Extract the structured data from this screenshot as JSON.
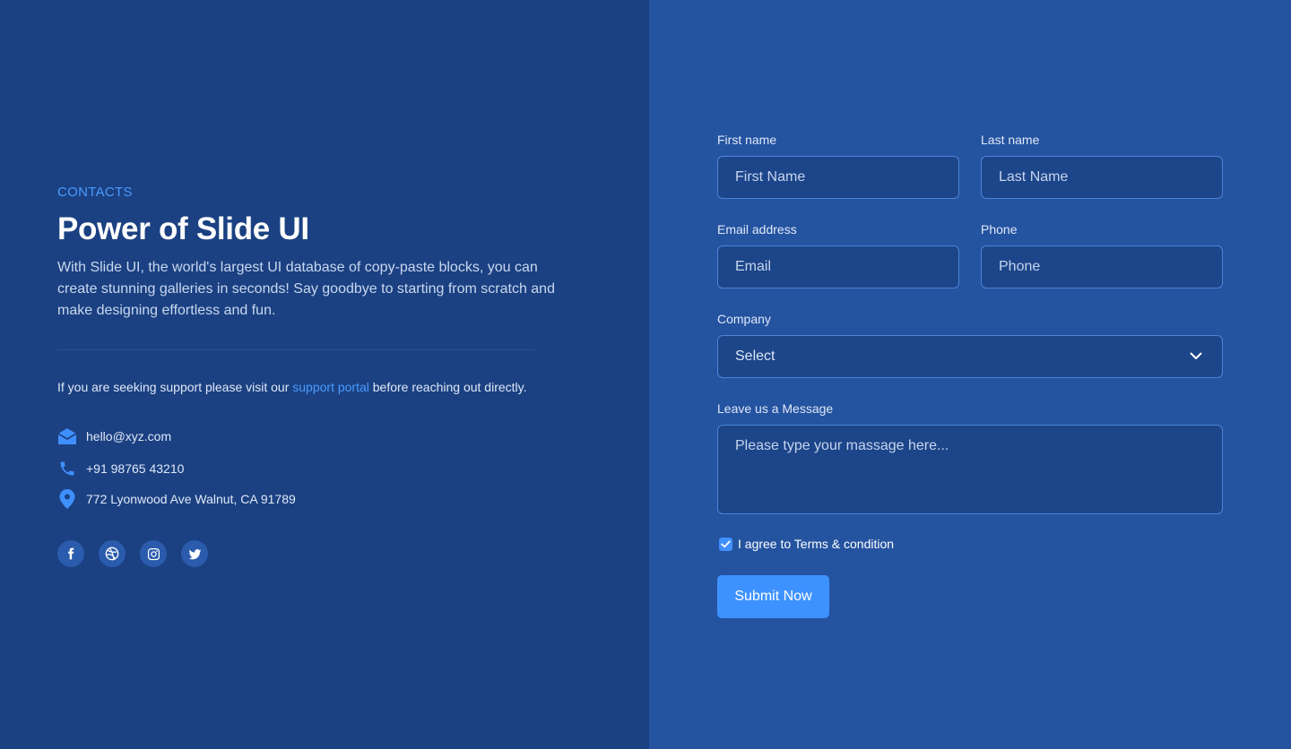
{
  "contact": {
    "eyebrow": "CONTACTS",
    "title": "Power of Slide UI",
    "description": "With Slide UI, the world's largest UI database of copy-paste blocks, you can create stunning galleries in seconds! Say goodbye to starting from scratch and make designing effortless and fun.",
    "support_prefix": "If you are seeking support please visit our ",
    "support_link": "support portal",
    "support_suffix": " before reaching out directly.",
    "email": "hello@xyz.com",
    "phone": "+91 98765 43210",
    "address": "772 Lyonwood Ave Walnut, CA 91789",
    "socials": [
      "facebook-icon",
      "dribbble-icon",
      "instagram-icon",
      "twitter-icon"
    ]
  },
  "form": {
    "first_name_label": "First name",
    "first_name_placeholder": "First Name",
    "first_name_value": "",
    "last_name_label": "Last name",
    "last_name_placeholder": "Last Name",
    "last_name_value": "",
    "email_label": "Email address",
    "email_placeholder": "Email",
    "email_value": "",
    "phone_label": "Phone",
    "phone_placeholder": "Phone",
    "phone_value": "",
    "company_label": "Company",
    "company_selected": "Select",
    "message_label": "Leave us a Message",
    "message_placeholder": "Please type your massage here...",
    "message_value": "",
    "agree_label": "I agree to Terms & condition",
    "agree_checked": true,
    "submit_label": "Submit Now"
  },
  "colors": {
    "left_bg": "#1b4182",
    "right_bg": "#2453a0",
    "accent": "#4a9bff",
    "button": "#3e92ff"
  }
}
